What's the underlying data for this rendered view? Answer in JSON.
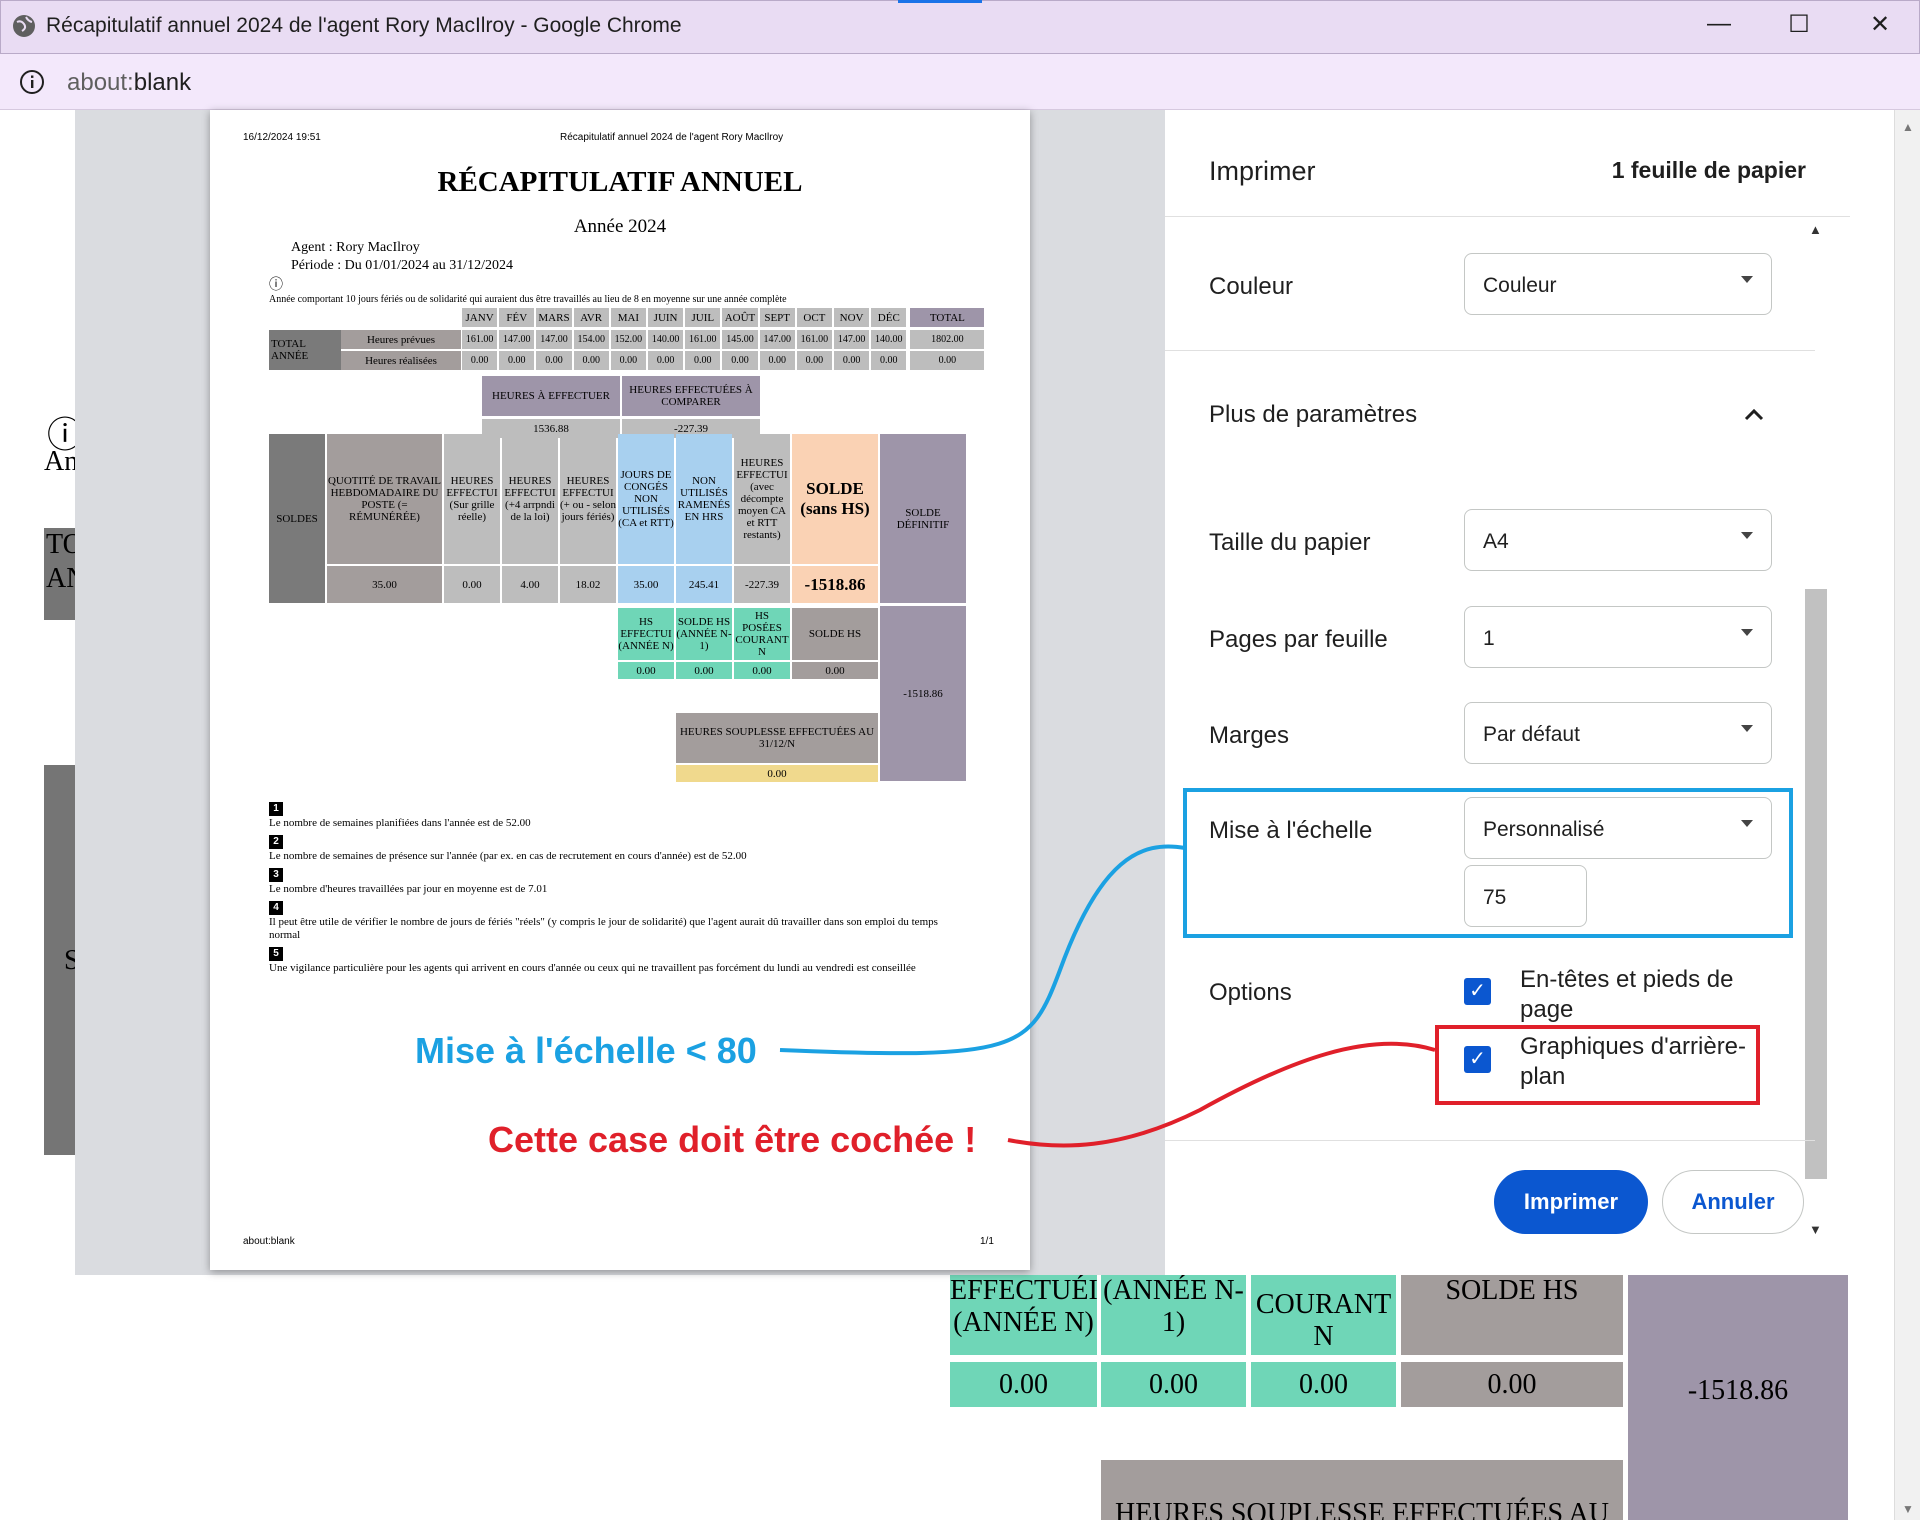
{
  "window": {
    "title": "Récapitulatif annuel 2024 de l'agent Rory MacIlroy - Google Chrome",
    "url_prefix": "about:",
    "url_path": "blank",
    "minimize": "—",
    "maximize": "☐",
    "close": "✕"
  },
  "underlying": {
    "info_glyph": "ⓘ",
    "an": "An",
    "to": "TO",
    "an2": "AN",
    "s": "S",
    "tiles": [
      "EFFECTUÉI (ANNÉE N)",
      "(ANNÉE N-1)",
      "COURANT N",
      "SOLDE HS"
    ],
    "tile_values": [
      "0.00",
      "0.00",
      "0.00",
      "0.00"
    ],
    "solde_def": "-1518.86",
    "souplesse": "HEURES SOUPLESSE EFFECTUÉES AU"
  },
  "paper": {
    "header_date": "16/12/2024 19:51",
    "header_title": "Récapitulatif annuel 2024 de l'agent Rory MacIlroy",
    "title": "RÉCAPITULATIF ANNUEL",
    "year": "Année 2024",
    "agent": "Agent : Rory MacIlroy",
    "periode": "Période : Du 01/01/2024 au 31/12/2024",
    "info_icon": "ⓘ",
    "jours_feries": "Année comportant 10 jours fériés ou de solidarité qui auraient dus être travaillés au lieu de 8 en moyenne sur une année complète",
    "months": [
      "JANV",
      "FÉV",
      "MARS",
      "AVR",
      "MAI",
      "JUIN",
      "JUIL",
      "AOÛT",
      "SEPT",
      "OCT",
      "NOV",
      "DÉC",
      "TOTAL"
    ],
    "total_annee": "TOTAL ANNÉE",
    "heures_prevues_label": "Heures prévues",
    "heures_realisees_label": "Heures réalisées",
    "heures_prevues": [
      "161.00",
      "147.00",
      "147.00",
      "154.00",
      "152.00",
      "140.00",
      "161.00",
      "145.00",
      "147.00",
      "161.00",
      "147.00",
      "140.00",
      "1802.00"
    ],
    "heures_realisees": [
      "0.00",
      "0.00",
      "0.00",
      "0.00",
      "0.00",
      "0.00",
      "0.00",
      "0.00",
      "0.00",
      "0.00",
      "0.00",
      "0.00",
      "0.00"
    ],
    "heures_effectuer_label": "HEURES À EFFECTUER",
    "heures_effectuer_value": "1536.88",
    "heures_comparer_label": "HEURES EFFECTUÉES À COMPARER",
    "heures_comparer_value": "-227.39",
    "soldes": "SOLDES",
    "quotite": "QUOTITÉ DE TRAVAIL HEBDOMADAIRE DU POSTE (= RÉMUNÉRÉE)",
    "heures_eff_grille": "HEURES EFFECTUI (Sur grille réelle)",
    "heures_eff_arr": "HEURES EFFECTUI (+4 arrpndi de la loi)",
    "heures_eff_feries": "HEURES EFFECTUI (+ ou - selon jours fériés)",
    "jours_conges": "JOURS DE CONGÉS NON UTILISÉS (CA et RTT)",
    "non_utilises": "NON UTILISÉS RAMENÉS EN HRS",
    "heures_decompte": "HEURES EFFECTUI (avec décompte moyen CA et RTT restants)",
    "solde_sans_hs": "SOLDE (sans HS)",
    "solde_definitif": "SOLDE DÉFINITIF",
    "values_row": [
      "35.00",
      "0.00",
      "4.00",
      "18.02",
      "35.00",
      "245.41",
      "-227.39",
      "-1518.86"
    ],
    "hs_effectuees": "HS EFFECTUI (ANNÉE N)",
    "solde_hs_n1": "SOLDE HS (ANNÉE N-1)",
    "hs_posees": "HS POSÉES COURANT N",
    "solde_hs": "SOLDE HS",
    "hs_values": [
      "0.00",
      "0.00",
      "0.00",
      "0.00"
    ],
    "solde_definitif_value": "-1518.86",
    "souplesse_label": "HEURES SOUPLESSE EFFECTUÉES AU 31/12/N",
    "souplesse_value": "0.00",
    "notes": [
      {
        "n": "1",
        "text": "Le nombre de semaines planifiées dans l'année est de 52.00"
      },
      {
        "n": "2",
        "text": "Le nombre de semaines de présence sur l'année (par ex. en cas de recrutement en cours d'année) est de 52.00"
      },
      {
        "n": "3",
        "text": "Le nombre d'heures travaillées par jour en moyenne est de 7.01"
      },
      {
        "n": "4",
        "text": "Il peut être utile de vérifier le nombre de jours de fériés \"réels\" (y compris le jour de solidarité) que l'agent aurait dû travailler dans son emploi du temps normal"
      },
      {
        "n": "5",
        "text": "Une vigilance particulière pour les agents qui arrivent en cours d'année ou ceux qui ne travaillent pas forcément du lundi au vendredi est conseillée"
      }
    ],
    "footer_left": "about:blank",
    "footer_right": "1/1"
  },
  "annotations": {
    "scale_note": "Mise à l'échelle < 80",
    "scale_color": "#1ba1e2",
    "checkbox_note": "Cette case doit être cochée !",
    "checkbox_color": "#e0202a"
  },
  "dialog": {
    "title": "Imprimer",
    "sheets": "1 feuille de papier",
    "couleur_label": "Couleur",
    "couleur_value": "Couleur",
    "plus_params": "Plus de paramètres",
    "taille_label": "Taille du papier",
    "taille_value": "A4",
    "pages_label": "Pages par feuille",
    "pages_value": "1",
    "marges_label": "Marges",
    "marges_value": "Par défaut",
    "echelle_label": "Mise à l'échelle",
    "echelle_value": "Personnalisé",
    "echelle_input": "75",
    "options_label": "Options",
    "opt_headers": "En-têtes et pieds de page",
    "opt_background": "Graphiques d'arrière-plan",
    "print_button": "Imprimer",
    "cancel_button": "Annuler",
    "accent": "#0b57d0"
  }
}
